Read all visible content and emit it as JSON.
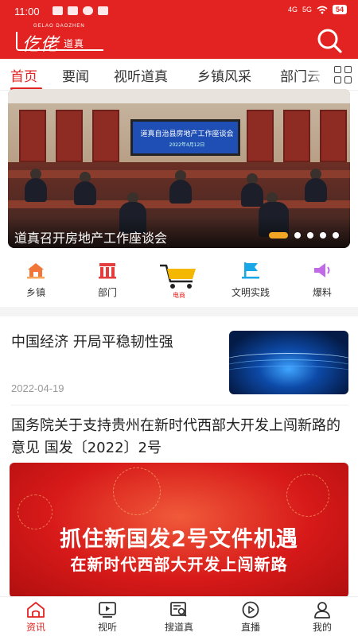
{
  "status_bar": {
    "time": "11:00",
    "network": "4G",
    "network2": "5G",
    "battery": "54"
  },
  "header": {
    "logo_subtitle": "GELAO DAOZHEN",
    "logo_main": "仡佬",
    "logo_tail": "道真",
    "brand_color": "#e32321"
  },
  "tabs": [
    {
      "label": "首页",
      "active": true
    },
    {
      "label": "要闻"
    },
    {
      "label": "视听道真"
    },
    {
      "label": "乡镇风采"
    },
    {
      "label": "部门云"
    }
  ],
  "banner": {
    "caption": "道真召开房地产工作座谈会",
    "screen_title": "道真自治县房地产工作座谈会",
    "screen_date": "2022年4月12日",
    "slide_count": 5,
    "active_slide": 1
  },
  "quick_nav": [
    {
      "label": "乡镇",
      "icon": "house-icon"
    },
    {
      "label": "部门",
      "icon": "building-icon"
    },
    {
      "label": "电商",
      "icon": "shopping-cart-icon"
    },
    {
      "label": "文明实践",
      "icon": "flag-icon"
    },
    {
      "label": "爆料",
      "icon": "megaphone-icon"
    }
  ],
  "news": [
    {
      "title": "中国经济  开局平稳韧性强",
      "date": "2022-04-19",
      "thumbnail": "blue-data-wave-image"
    },
    {
      "title": "国务院关于支持贵州在新时代西部大开发上闯新路的意见  国发〔2022〕2号",
      "image_headline": "抓住新国发2号文件机遇",
      "image_subheadline": "在新时代西部大开发上闯新路"
    }
  ],
  "bottom_nav": [
    {
      "label": "资讯",
      "icon": "home-icon",
      "active": true
    },
    {
      "label": "视听",
      "icon": "tv-icon"
    },
    {
      "label": "搜道真",
      "icon": "search-doc-icon"
    },
    {
      "label": "直播",
      "icon": "play-circle-icon"
    },
    {
      "label": "我的",
      "icon": "user-icon"
    }
  ]
}
